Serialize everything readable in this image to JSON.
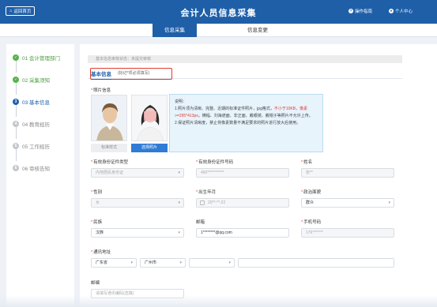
{
  "header": {
    "back_label": "返回首页",
    "title": "会计人员信息采集",
    "guide_label": "操作指南",
    "user_label": "个人中心"
  },
  "tabs": [
    {
      "label": "信息采集",
      "active": true
    },
    {
      "label": "信息变更",
      "active": false
    }
  ],
  "steps": [
    {
      "num": "✓",
      "label": "01 会计管理部门",
      "state": "done"
    },
    {
      "num": "✓",
      "label": "02 采集须知",
      "state": "done"
    },
    {
      "num": "3",
      "label": "03 基本信息",
      "state": "current"
    },
    {
      "num": "4",
      "label": "04 教育经历",
      "state": "todo"
    },
    {
      "num": "5",
      "label": "05 工作经历",
      "state": "todo"
    },
    {
      "num": "6",
      "label": "06 审核告知",
      "state": "todo"
    }
  ],
  "main": {
    "status_text": "基本信息审核状态：未提交审核",
    "subtab_label": "基本信息",
    "subtab_note": "(标记*项必须填写)",
    "photo_label": "照片信息",
    "photo_cards": [
      {
        "caption": "标准样式"
      },
      {
        "caption": "选择照片"
      }
    ],
    "description": {
      "title": "说明：",
      "line1_prefix": "1.照片须为清晰、完整、近期的标准证件照片，jpg格式，",
      "line1_red": "不小于10KB，像素>=295*413px",
      "line1_suffix": "，横幅、刘海遮面、非正面、戴眼镜、戴帽子等照片不允许上传。",
      "line2": "2.保证照片清晰度，禁止将像素数量不满足要求的照片进行放大后使用。"
    },
    "fields": {
      "id_type": {
        "label": "有效身份证件类型",
        "value": "内地居民身份证"
      },
      "id_number": {
        "label": "有效身份证件号码",
        "value": "460***********"
      },
      "name": {
        "label": "姓名",
        "value": "张**"
      },
      "gender": {
        "label": "性别",
        "value": "女"
      },
      "birth": {
        "label": "出生年月",
        "value": "20**-**-22"
      },
      "politics": {
        "label": "政治面貌",
        "value": "群众"
      },
      "ethnicity": {
        "label": "民族",
        "value": "汉族"
      },
      "email": {
        "label": "邮箱",
        "value": "1********@qq.com"
      },
      "phone": {
        "label": "手机号码",
        "value": "176*******"
      },
      "address_label": "通讯地址",
      "province": "广东省",
      "city": "广州市",
      "district": "",
      "address_detail": "",
      "postcode": {
        "label": "邮编",
        "placeholder": "请填写通讯编码(选填)"
      }
    }
  }
}
